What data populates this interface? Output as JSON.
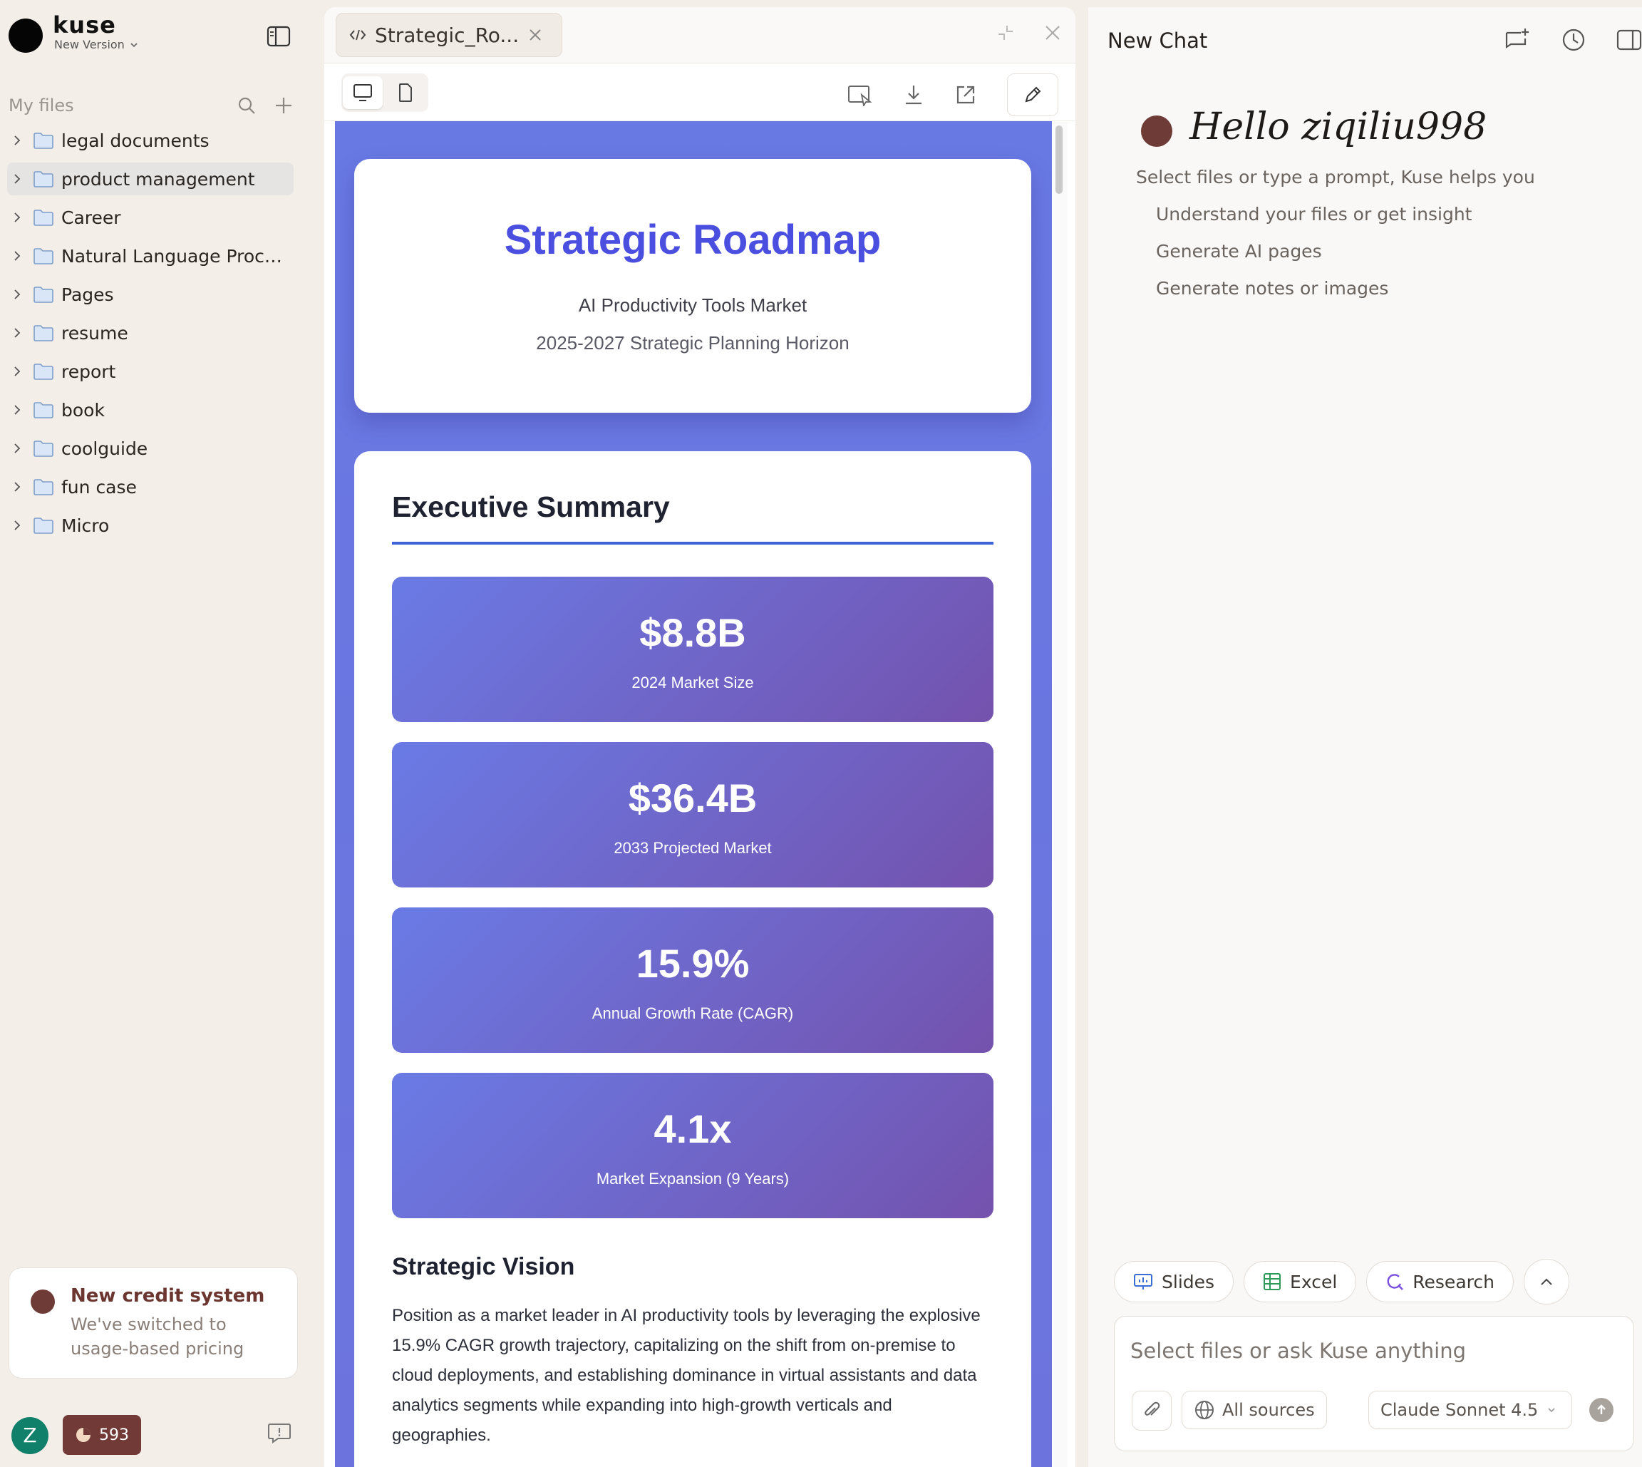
{
  "brand": {
    "name": "kuse",
    "version_label": "New Version"
  },
  "sidebar": {
    "section_label": "My files",
    "folders": [
      {
        "label": "legal documents",
        "active": false
      },
      {
        "label": "product management",
        "active": true
      },
      {
        "label": "Career",
        "active": false
      },
      {
        "label": "Natural Language Proce...",
        "active": false
      },
      {
        "label": "Pages",
        "active": false
      },
      {
        "label": "resume",
        "active": false
      },
      {
        "label": "report",
        "active": false
      },
      {
        "label": "book",
        "active": false
      },
      {
        "label": "coolguide",
        "active": false
      },
      {
        "label": "fun case",
        "active": false
      },
      {
        "label": "Micro",
        "active": false
      }
    ],
    "credit_card": {
      "title": "New credit system",
      "subtitle": "We've switched to usage-based pricing"
    },
    "user_initial": "Z",
    "credits": "593"
  },
  "editor": {
    "tab_label": "Strategic_Ro...",
    "document": {
      "title": "Strategic Roadmap",
      "subtitle": "AI Productivity Tools Market",
      "horizon": "2025-2027 Strategic Planning Horizon",
      "section_title": "Executive Summary",
      "metrics": [
        {
          "value": "$8.8B",
          "label": "2024 Market Size"
        },
        {
          "value": "$36.4B",
          "label": "2033 Projected Market"
        },
        {
          "value": "15.9%",
          "label": "Annual Growth Rate (CAGR)"
        },
        {
          "value": "4.1x",
          "label": "Market Expansion (9 Years)"
        }
      ],
      "vision_title": "Strategic Vision",
      "vision_text": "Position as a market leader in AI productivity tools by leveraging the explosive 15.9% CAGR growth trajectory, capitalizing on the shift from on-premise to cloud deployments, and establishing dominance in virtual assistants and data analytics segments while expanding into high-growth verticals and geographies."
    }
  },
  "chat": {
    "title": "New Chat",
    "greeting": "Hello ziqiliu998",
    "hint": "Select files or type a prompt, Kuse helps you",
    "suggestions": [
      "Understand your files or get insight",
      "Generate AI pages",
      "Generate notes or images"
    ],
    "quick_actions": [
      "Slides",
      "Excel",
      "Research"
    ],
    "input_placeholder": "Select files or ask Kuse anything",
    "sources_label": "All sources",
    "model_label": "Claude Sonnet 4.5"
  },
  "colors": {
    "accent_brown": "#6f3b37",
    "doc_title_blue": "#4b4fe0",
    "metric_gradient_start": "#6a7be6",
    "metric_gradient_end": "#7452ad",
    "preview_bg": "#6979e4"
  },
  "icons": {
    "sidebar_toggle": "sidebar-toggle-icon",
    "search": "search-icon",
    "add": "plus-icon",
    "folder": "folder-icon",
    "code": "code-icon",
    "close": "close-icon",
    "desktop": "desktop-icon",
    "mobile": "mobile-icon",
    "download": "download-icon",
    "external": "external-link-icon",
    "edit": "pencil-icon",
    "new_chat": "new-chat-icon",
    "history": "clock-icon",
    "panel": "panel-icon",
    "attach": "paperclip-icon",
    "globe": "globe-icon",
    "send": "send-icon"
  }
}
